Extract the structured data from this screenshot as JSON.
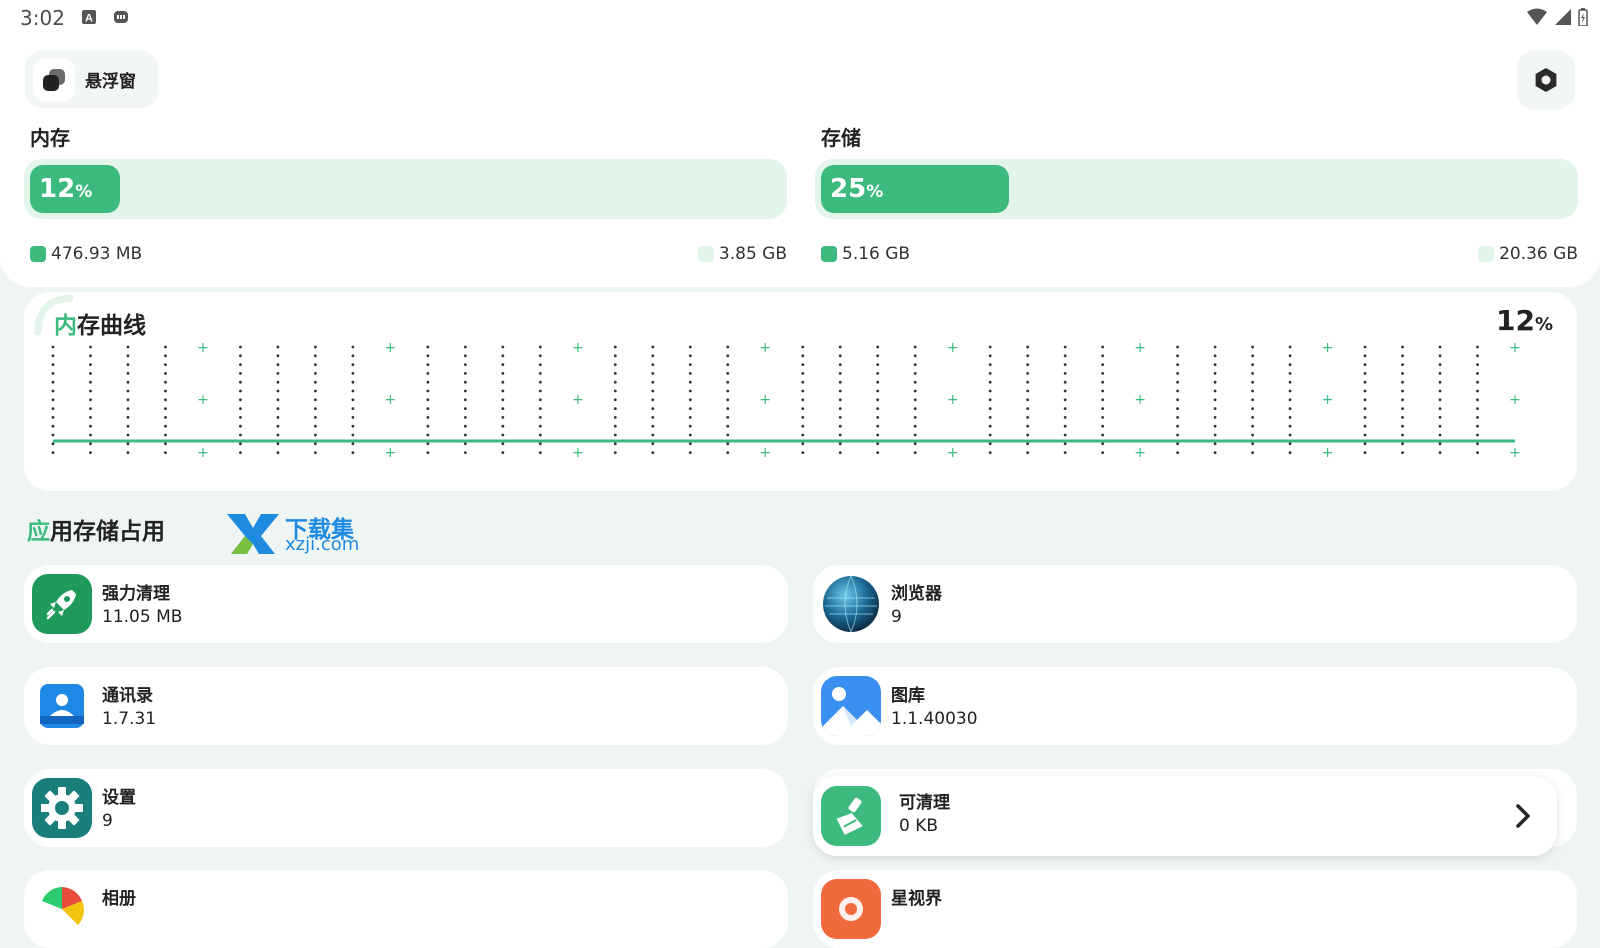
{
  "status_bar": {
    "time": "3:02",
    "left_icons": [
      "a-letter-icon",
      "android-debug-icon"
    ],
    "right_icons": [
      "wifi-icon",
      "cell-signal-icon",
      "battery-icon"
    ]
  },
  "header": {
    "floating_window_label": "悬浮窗",
    "floating_window_icon": "floating-window-icon",
    "settings_icon": "hexagon-settings-icon"
  },
  "memory": {
    "label": "内存",
    "percent": "12",
    "percent_unit": "%",
    "used": "476.93 MB",
    "total": "3.85 GB",
    "fraction": 0.12
  },
  "storage": {
    "label": "存储",
    "percent": "25",
    "percent_unit": "%",
    "used": "5.16 GB",
    "total": "20.36 GB",
    "fraction": 0.25
  },
  "memory_curve": {
    "title_accent": "内",
    "title_rest": "存曲线",
    "percent": "12",
    "percent_unit": "%"
  },
  "chart_data": {
    "type": "line",
    "title": "内存曲线",
    "ylim": [
      0,
      100
    ],
    "grid": "dotted-columns",
    "series": [
      {
        "values": [
          12,
          12,
          12,
          12,
          12,
          12,
          12,
          12,
          12,
          12,
          12,
          12,
          12,
          12,
          12,
          12,
          12,
          12,
          12,
          12,
          12,
          12,
          12,
          12,
          12,
          12,
          12,
          12,
          12,
          12,
          12,
          12,
          12,
          12,
          12,
          12,
          12,
          12,
          12,
          12
        ]
      }
    ]
  },
  "apps_section": {
    "title_accent": "应",
    "title_rest": "用存储占用"
  },
  "watermark": {
    "text_cn": "下载集",
    "text_en": "xzji.com"
  },
  "apps": [
    {
      "name": "强力清理",
      "value": "11.05 MB",
      "icon": "rocket-icon",
      "color": "#1f9a5a"
    },
    {
      "name": "浏览器",
      "value": "9",
      "icon": "globe-icon",
      "color": "#1b4f72"
    },
    {
      "name": "通讯录",
      "value": "1.7.31",
      "icon": "contacts-icon",
      "color": "#1e88e5"
    },
    {
      "name": "图库",
      "value": "1.1.40030",
      "icon": "gallery-icon",
      "color": "#3b8ff0"
    },
    {
      "name": "设置",
      "value": "9",
      "icon": "gear-icon",
      "color": "#1a7f7a"
    },
    {
      "name": "相册",
      "value": "",
      "icon": "photos-icon",
      "color": "#e74c3c"
    },
    {
      "name": "星视界",
      "value": "",
      "icon": "star-vision-icon",
      "color": "#f06a3c"
    }
  ],
  "cleanable": {
    "label": "可清理",
    "value": "0 KB",
    "icon": "broom-icon",
    "color": "#3dbb7e"
  },
  "colors": {
    "accent": "#3dbb7e",
    "track": "#e3f4ea",
    "background": "#eff5f2"
  }
}
